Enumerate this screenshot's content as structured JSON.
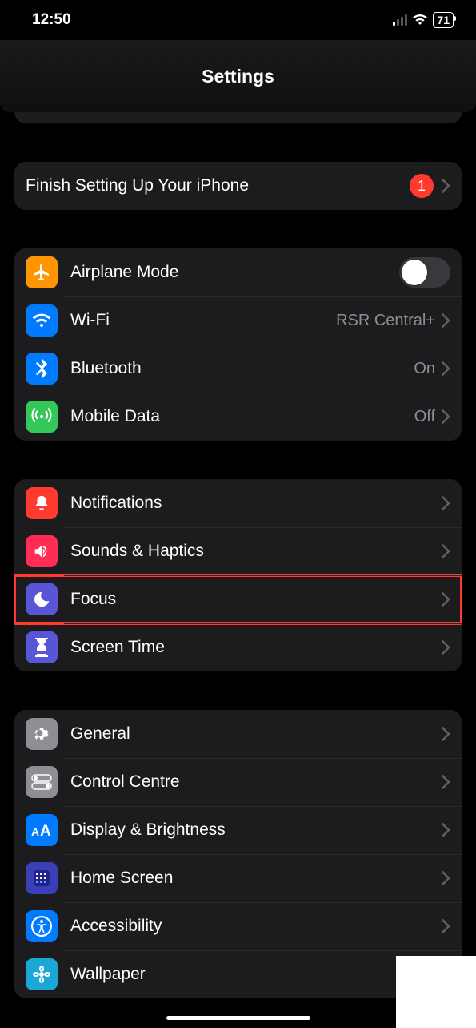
{
  "statusbar": {
    "time": "12:50",
    "battery": "71"
  },
  "header": {
    "title": "Settings"
  },
  "setup": {
    "label": "Finish Setting Up Your iPhone",
    "badge": "1"
  },
  "connectivity": {
    "airplane": "Airplane Mode",
    "wifi": "Wi-Fi",
    "wifi_value": "RSR Central+",
    "bluetooth": "Bluetooth",
    "bluetooth_value": "On",
    "mobile": "Mobile Data",
    "mobile_value": "Off"
  },
  "alerts": {
    "notifications": "Notifications",
    "sounds": "Sounds & Haptics",
    "focus": "Focus",
    "screentime": "Screen Time"
  },
  "system": {
    "general": "General",
    "control": "Control Centre",
    "display": "Display & Brightness",
    "home": "Home Screen",
    "accessibility": "Accessibility",
    "wallpaper": "Wallpaper"
  }
}
